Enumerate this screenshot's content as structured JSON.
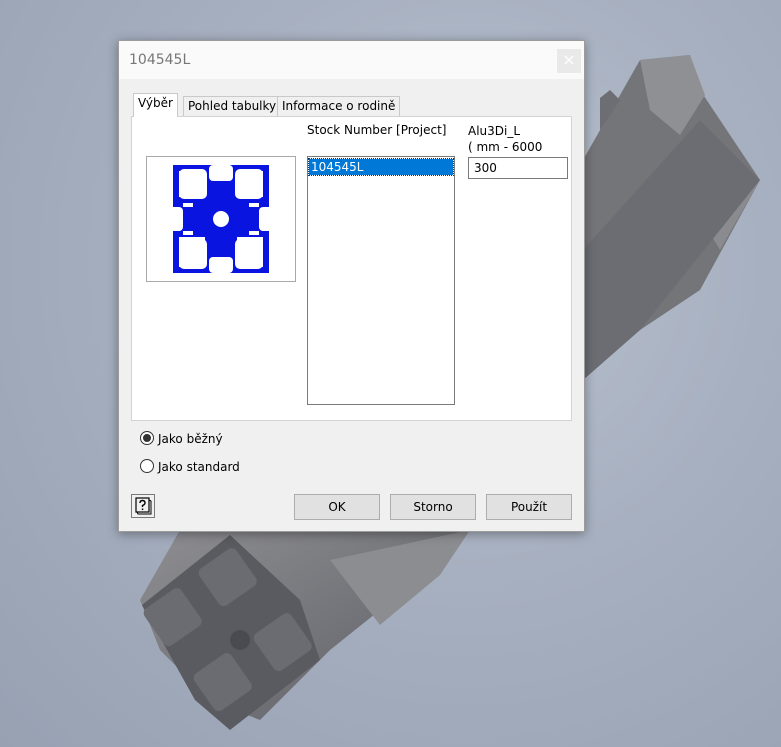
{
  "dialog": {
    "title": "104545L",
    "close_glyph": "×",
    "tabs": [
      {
        "label": "Výběr",
        "active": true
      },
      {
        "label": "Pohled tabulky",
        "active": false
      },
      {
        "label": "Informace o rodině",
        "active": false
      }
    ],
    "selection": {
      "list_header": "Stock Number [Project]",
      "items": [
        "104545L"
      ],
      "selected_item": "104545L",
      "parameter_name": "Alu3Di_L",
      "parameter_range": "( mm - 6000",
      "parameter_value": "300"
    },
    "options": [
      {
        "label": "Jako běžný",
        "checked": true
      },
      {
        "label": "Jako standard",
        "checked": false
      }
    ],
    "help_icon": "help-icon",
    "buttons": {
      "ok": "OK",
      "cancel": "Storno",
      "apply": "Použít"
    }
  },
  "colors": {
    "profile_preview": "#0a14e0",
    "selection_highlight": "#0078d7"
  }
}
